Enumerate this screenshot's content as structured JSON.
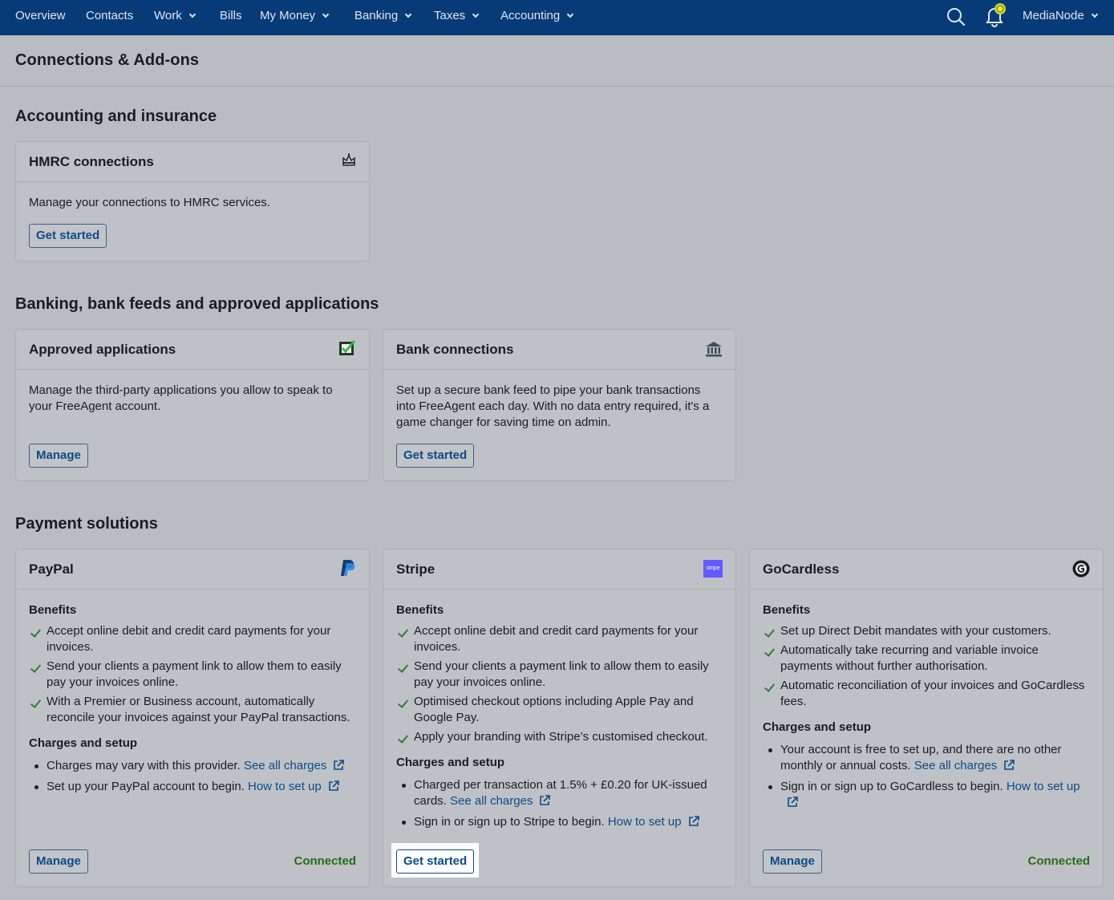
{
  "nav": {
    "items": [
      "Overview",
      "Contacts",
      "Work",
      "Bills",
      "My Money",
      "Banking",
      "Taxes",
      "Accounting"
    ],
    "account": "MediaNode"
  },
  "page": {
    "title": "Connections & Add-ons"
  },
  "sections": {
    "accounting": "Accounting and insurance",
    "banking": "Banking, bank feeds and approved applications",
    "payments": "Payment solutions"
  },
  "hmrc": {
    "title": "HMRC connections",
    "description": "Manage your connections to HMRC services.",
    "button": "Get started"
  },
  "approved": {
    "title": "Approved applications",
    "description": "Manage the third-party applications you allow to speak to your FreeAgent account.",
    "button": "Manage"
  },
  "bank": {
    "title": "Bank connections",
    "description": "Set up a secure bank feed to pipe your bank transactions into FreeAgent each day. With no data entry required, it's a game changer for saving time on admin.",
    "button": "Get started"
  },
  "paypal": {
    "title": "PayPal",
    "benefits_heading": "Benefits",
    "benefits": [
      "Accept online debit and credit card payments for your invoices.",
      "Send your clients a payment link to allow them to easily pay your invoices online.",
      "With a Premier or Business account, automatically reconcile your invoices against your PayPal transactions."
    ],
    "charges_heading": "Charges and setup",
    "charge1_text": "Charges may vary with this provider.",
    "charge1_link": "See all charges",
    "charge2_text": "Set up your PayPal account to begin.",
    "charge2_link": "How to set up",
    "button": "Manage",
    "status": "Connected"
  },
  "stripe": {
    "title": "Stripe",
    "logo_text": "stripe",
    "benefits_heading": "Benefits",
    "benefits": [
      "Accept online debit and credit card payments for your invoices.",
      "Send your clients a payment link to allow them to easily pay your invoices online.",
      "Optimised checkout options including Apple Pay and Google Pay.",
      "Apply your branding with Stripe’s customised checkout."
    ],
    "charges_heading": "Charges and setup",
    "charge1_text": "Charged per transaction at 1.5% + £0.20 for UK-issued cards.",
    "charge1_link": "See all charges",
    "charge2_text": "Sign in or sign up to Stripe to begin.",
    "charge2_link": "How to set up",
    "button": "Get started"
  },
  "gocardless": {
    "title": "GoCardless",
    "benefits_heading": "Benefits",
    "benefits": [
      "Set up Direct Debit mandates with your customers.",
      "Automatically take recurring and variable invoice payments without further authorisation.",
      "Automatic reconciliation of your invoices and GoCardless fees."
    ],
    "charges_heading": "Charges and setup",
    "charge1_text": "Your account is free to set up, and there are no other monthly or annual costs.",
    "charge1_link": "See all charges",
    "charge2_text": "Sign in or sign up to GoCardless to begin.",
    "charge2_link": "How to set up",
    "button": "Manage",
    "status": "Connected"
  },
  "colors": {
    "nav_bg": "#073b78",
    "link": "#0d4a88",
    "connected": "#2a6a1f",
    "check": "#2e7d3b",
    "stripe_brand": "#635bff"
  },
  "icons": [
    "search-icon",
    "bell-icon",
    "crown-icon",
    "checkbox-icon",
    "bank-icon",
    "paypal-icon",
    "stripe-icon",
    "gocardless-icon",
    "external-link-icon"
  ]
}
